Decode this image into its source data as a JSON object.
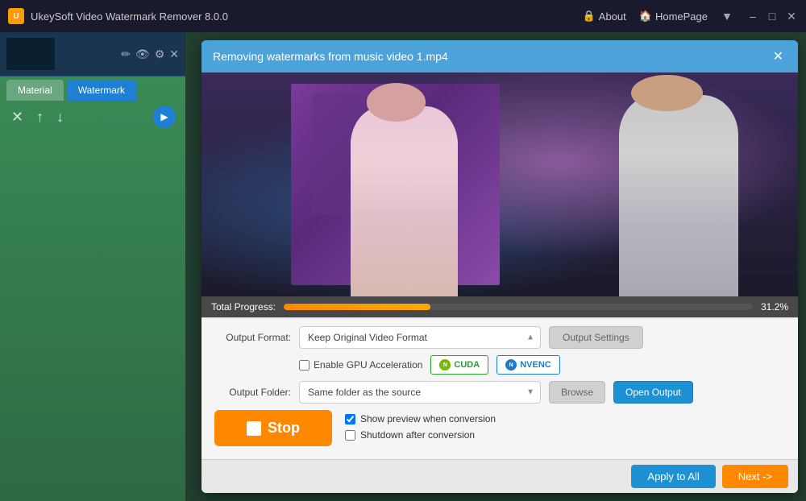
{
  "titlebar": {
    "logo_text": "U",
    "app_title": "UkeySoft Video Watermark Remover 8.0.0",
    "nav": {
      "about_icon": "🔒",
      "about_label": "About",
      "homepage_icon": "🏠",
      "homepage_label": "HomePage",
      "dropdown_icon": "▼"
    },
    "controls": {
      "minimize": "–",
      "maximize": "□",
      "close": "✕"
    }
  },
  "sidebar": {
    "thumb_close": "✕",
    "thumb_icons": [
      "✏",
      "👁",
      "⚙"
    ],
    "tab_material": "Material",
    "tab_watermark": "Watermark",
    "tool_delete": "✕",
    "tool_up": "↑",
    "tool_down": "↓"
  },
  "modal": {
    "title": "Removing watermarks from music video 1.mp4",
    "close": "✕",
    "progress_label": "Total Progress:",
    "progress_pct": "31.2%",
    "progress_value": 31.2,
    "output_format_label": "Output Format:",
    "output_format_value": "Keep Original Video Format",
    "output_format_placeholder": "Keep Original Video Format",
    "output_settings_label": "Output Settings",
    "gpu_acceleration_label": "Enable GPU Acceleration",
    "cuda_label": "CUDA",
    "nvenc_label": "NVENC",
    "output_folder_label": "Output Folder:",
    "output_folder_value": "Same folder as the source",
    "browse_label": "Browse",
    "open_output_label": "Open Output",
    "stop_label": "Stop",
    "show_preview_label": "Show preview when conversion",
    "show_preview_checked": true,
    "shutdown_label": "Shutdown after conversion",
    "shutdown_checked": false,
    "apply_all_label": "Apply to All",
    "next_label": "Next ->"
  },
  "icons": {
    "stop_square": "■",
    "lock": "🔒",
    "home": "🏠"
  }
}
